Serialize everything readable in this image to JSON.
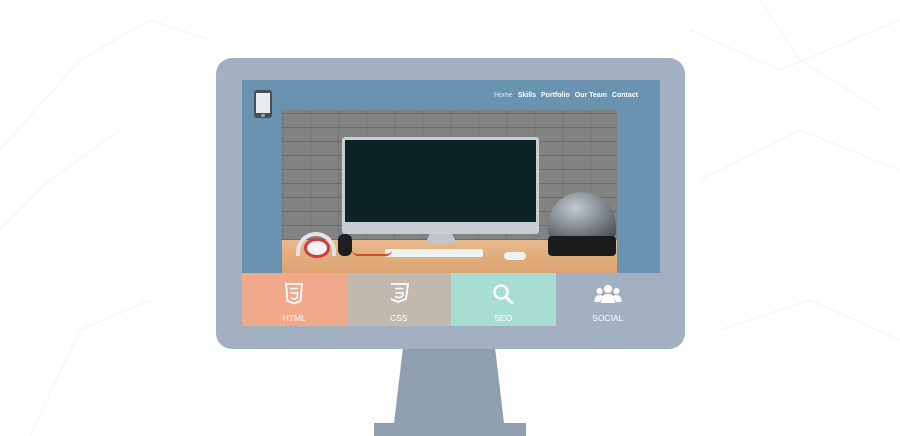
{
  "colors": {
    "background": "#ffffff",
    "monitor_frame": "#a2b0c2",
    "screen": "#6a93b2",
    "stand": "#8f9fb0"
  },
  "nav": {
    "items": [
      {
        "label": "Home",
        "active": true
      },
      {
        "label": "Skills"
      },
      {
        "label": "Portfolio"
      },
      {
        "label": "Our Team"
      },
      {
        "label": "Contact"
      }
    ]
  },
  "logo": {
    "icon": "smartphone-icon"
  },
  "hero": {
    "icon": "imac-desk-photo"
  },
  "tiles": [
    {
      "label": "HTML",
      "icon": "html5-icon",
      "color": "#f0a98b"
    },
    {
      "label": "CSS",
      "icon": "css3-icon",
      "color": "#c2b8ad"
    },
    {
      "label": "SEO",
      "icon": "magnifier-icon",
      "color": "#a8ddd2"
    },
    {
      "label": "SOCIAL",
      "icon": "people-icon",
      "color": "#a2b0c2"
    }
  ]
}
